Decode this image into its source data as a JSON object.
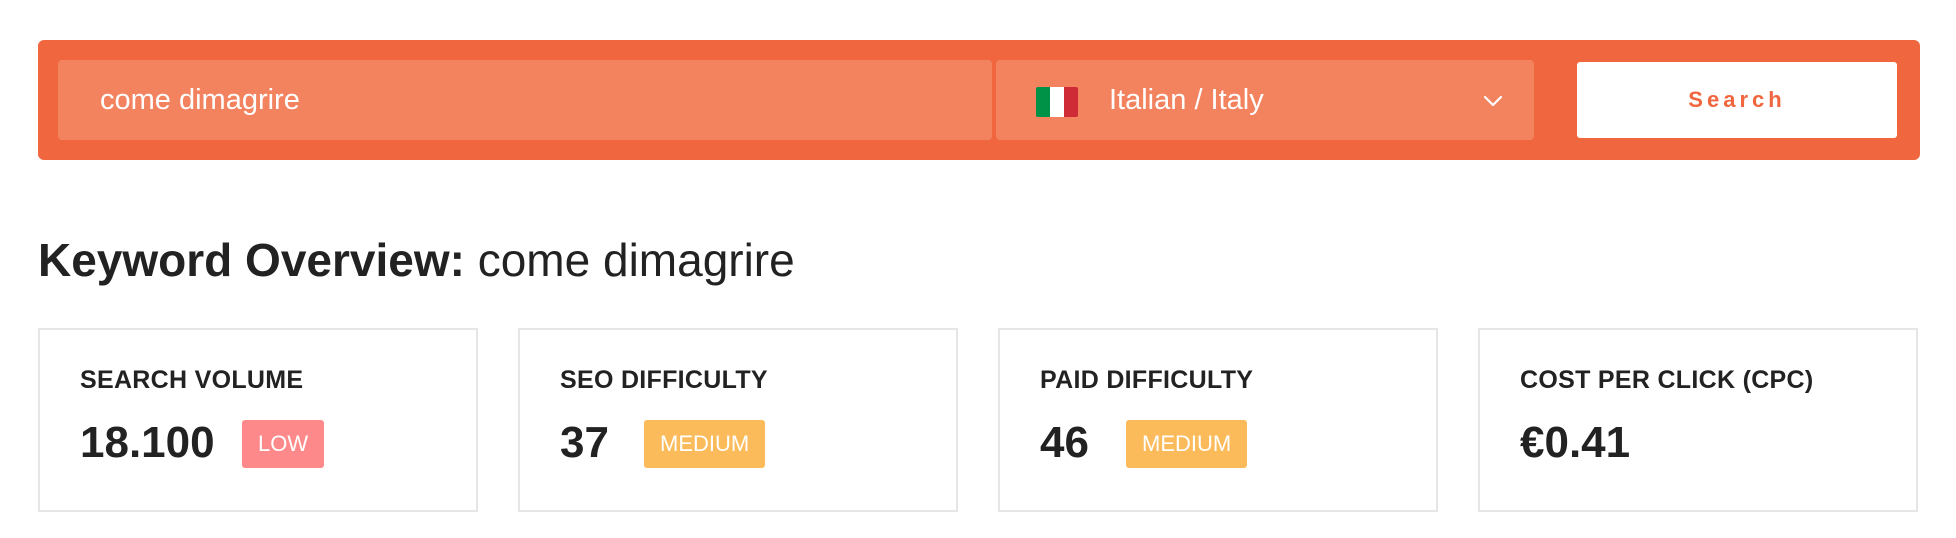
{
  "search": {
    "keyword_value": "come dimagrire",
    "locale_label": "Italian / Italy",
    "button_label": "Search"
  },
  "flag": {
    "name": "italy-flag-icon",
    "colors": [
      "#009246",
      "#ffffff",
      "#ce2b37"
    ]
  },
  "overview": {
    "title_prefix": "Keyword Overview:",
    "keyword": "come dimagrire"
  },
  "metrics": [
    {
      "label": "SEARCH VOLUME",
      "value": "18.100",
      "badge": "LOW",
      "badge_color": "#fd898a"
    },
    {
      "label": "SEO DIFFICULTY",
      "value": "37",
      "badge": "MEDIUM",
      "badge_color": "#fbbb5a"
    },
    {
      "label": "PAID DIFFICULTY",
      "value": "46",
      "badge": "MEDIUM",
      "badge_color": "#fbbb5a"
    },
    {
      "label": "COST PER CLICK (CPC)",
      "value": "€0.41"
    }
  ],
  "colors": {
    "accent": "#f0663e",
    "input_bg": "#f3825f",
    "card_border": "#e6e6e6",
    "text": "#222222"
  }
}
